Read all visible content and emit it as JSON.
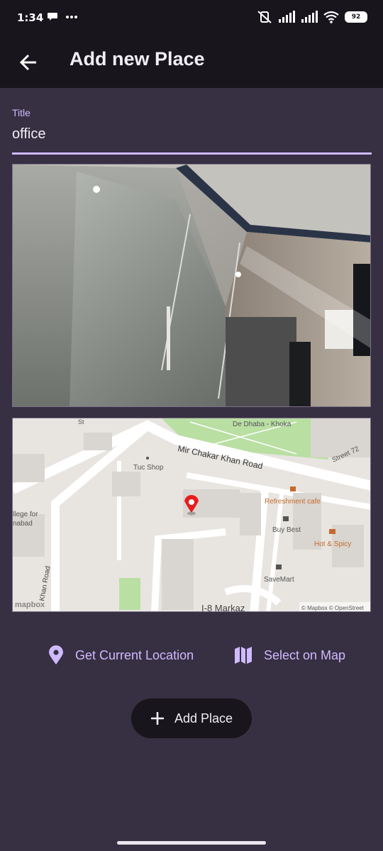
{
  "status_bar": {
    "time": "1:34",
    "battery": "92",
    "icons": [
      "chat-bubble-icon",
      "more-dots-icon",
      "mute-vibrate-icon",
      "signal-icon",
      "signal-icon",
      "wifi-icon",
      "battery-icon"
    ]
  },
  "app_bar": {
    "title": "Add new Place",
    "back_icon": "arrow-back-icon"
  },
  "title_field": {
    "label": "Title",
    "value": "office"
  },
  "photo": {
    "description_icon": "photo-preview"
  },
  "map": {
    "labels": {
      "de_dhaba": "De Dhaba - Khoka",
      "mir_chakar": "Mir Chakar Khan Road",
      "tuc_shop": "Tuc Shop",
      "street_72": "Street 72",
      "refreshment": "Refreshment cafe",
      "buy_best": "Buy Best",
      "hot_spicy": "Hot & Spicy",
      "savemart": "SaveMart",
      "i8_markaz": "I-8 Markaz",
      "college_1": "llege for",
      "college_2": "nabad",
      "khan_road": "Khan Road",
      "st_top": "St",
      "mapbox_logo": "mapbox",
      "attribution": "© Mapbox © OpenStreet"
    },
    "marker_icon": "location-pin-icon"
  },
  "actions": {
    "current_location_label": "Get Current Location",
    "current_location_icon": "location-pin-icon",
    "select_map_label": "Select on Map",
    "select_map_icon": "map-icon"
  },
  "add_button": {
    "label": "Add Place",
    "icon": "plus-icon"
  },
  "colors": {
    "background": "#372f42",
    "app_bar": "#18151c",
    "accent": "#cfbaff",
    "text": "#f1eef5"
  }
}
